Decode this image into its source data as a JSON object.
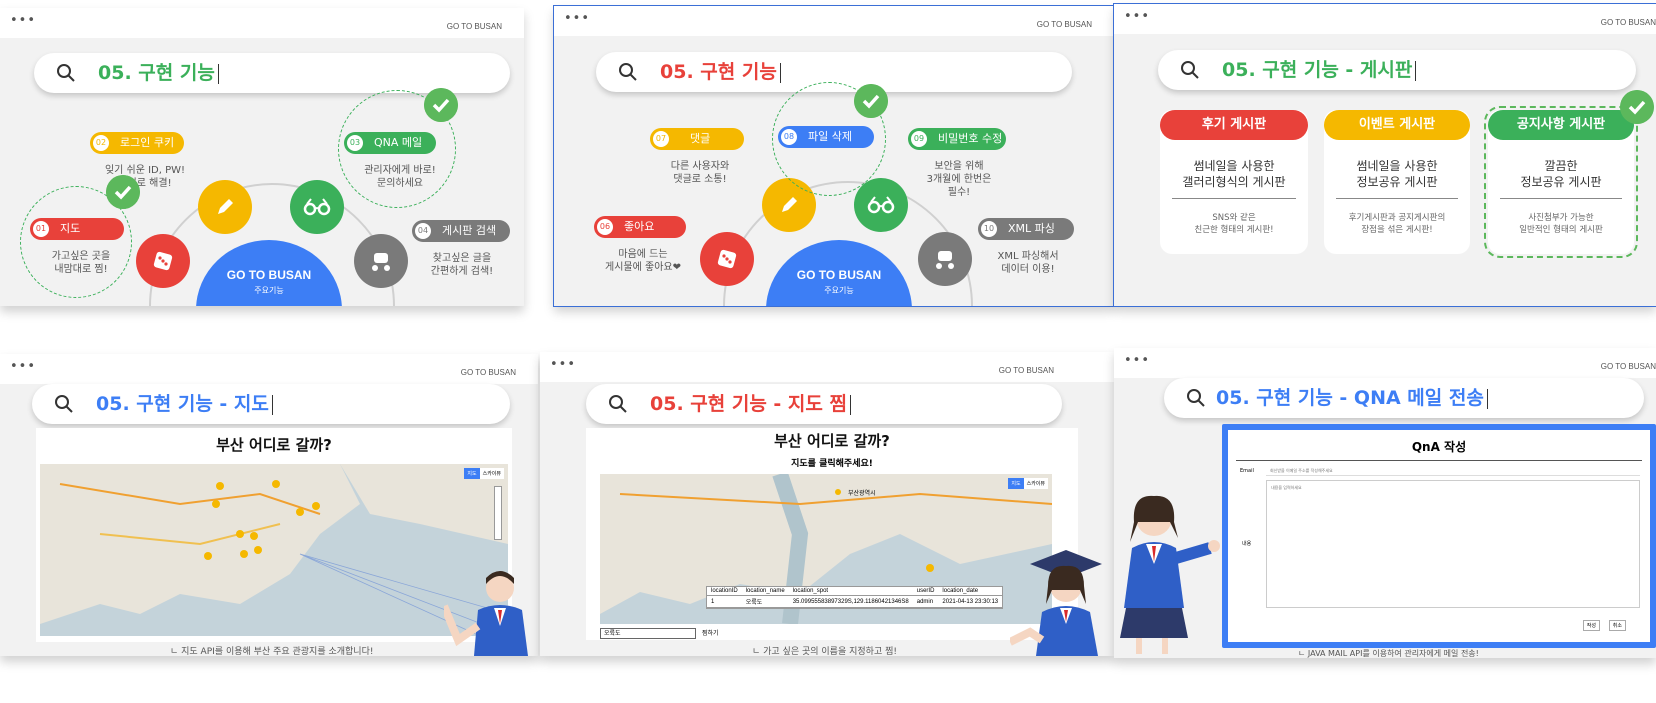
{
  "brand": "GO TO BUSAN",
  "slides": {
    "s1": {
      "title": "05. 구현 기능",
      "features": [
        {
          "num": "01",
          "label": "지도",
          "desc1": "가고싶은 곳을",
          "desc2": "내맘대로 찜!"
        },
        {
          "num": "02",
          "label": "로그인 쿠키",
          "desc1": "잊기 쉬운 ID, PW!",
          "desc2": "쿠키로 해결!"
        },
        {
          "num": "03",
          "label": "QNA 메일",
          "desc1": "관리자에게 바로!",
          "desc2": "문의하세요"
        },
        {
          "num": "04",
          "label": "게시판 검색",
          "desc1": "찾고싶은 글을",
          "desc2": "간편하게 검색!"
        }
      ],
      "hub_title": "GO TO BUSAN",
      "hub_sub": "주요기능"
    },
    "s2": {
      "title": "05. 구현 기능",
      "features": [
        {
          "num": "06",
          "label": "좋아요",
          "desc1": "마음에 드는",
          "desc2": "게시물에 좋아요❤"
        },
        {
          "num": "07",
          "label": "댓글",
          "desc1": "다른 사용자와",
          "desc2": "댓글로 소통!"
        },
        {
          "num": "08",
          "label": "파일 삭제",
          "desc1": "",
          "desc2": ""
        },
        {
          "num": "09",
          "label": "비밀번호 수정",
          "desc1": "보안을 위해",
          "desc2": "3개월에 한번은",
          "desc3": "필수!"
        },
        {
          "num": "10",
          "label": "XML 파싱",
          "desc1": "XML 파싱해서",
          "desc2": "데이터 이용!"
        }
      ],
      "hub_title": "GO TO BUSAN",
      "hub_sub": "주요기능"
    },
    "s3": {
      "title": "05. 구현 기능 - 게시판",
      "cards": [
        {
          "head": "후기 게시판",
          "main1": "썸네일을 사용한",
          "main2": "갤러리형식의 게시판",
          "sub1": "SNS와 같은",
          "sub2": "친근한 형태의 게시판!"
        },
        {
          "head": "이벤트 게시판",
          "main1": "썸네일을 사용한",
          "main2": "정보공유 게시판",
          "sub1": "후기게시판과 공지게시판의",
          "sub2": "장점을 섞은 게시판!"
        },
        {
          "head": "공지사항 게시판",
          "main1": "깔끔한",
          "main2": "정보공유 게시판",
          "sub1": "사진첨부가 가능한",
          "sub2": "일반적인 형태의 게시판"
        }
      ]
    },
    "s4": {
      "title": "05. 구현 기능 - 지도",
      "map_title": "부산 어디로 갈까?",
      "caption": "ㄴ 지도 API를 이용해 부산 주요 관광지를 소개합니다!",
      "map_toggle": [
        "지도",
        "스카이뷰"
      ]
    },
    "s5": {
      "title": "05. 구현 기능 - 지도 찜",
      "map_title": "부산 어디로 갈까?",
      "map_subtitle": "지도를 클릭해주세요!",
      "map_label": "부산광역시",
      "table_headers": [
        "locationID",
        "location_name",
        "location_spot",
        "userID",
        "location_date"
      ],
      "table_row": [
        "1",
        "오륙도",
        "35.09955583897329S,129.11860421346S8",
        "admin",
        "2021-04-13 23:30:13"
      ],
      "input_value": "오륙도",
      "button_label": "찜하기",
      "caption": "ㄴ 가고 싶은 곳의 이름을 지정하고 찜!"
    },
    "s6": {
      "title": "05. 구현 기능 - QNA 메일 전송",
      "form_title": "QnA 작성",
      "email_label": "Email",
      "email_placeholder": "회신받을 이메일 주소를 작성해주세요",
      "content_label": "내용",
      "content_placeholder": "내용을 입력하세요",
      "submit_label": "작성",
      "cancel_label": "취소",
      "caption": "ㄴ JAVA MAIL API를 이용하여 관리자에게 메일 전송!"
    }
  },
  "colors": {
    "green": "#3bb05a",
    "red": "#e8413a",
    "yellow": "#f5b800",
    "blue": "#3d7ef5",
    "gray": "#7a7a7a"
  }
}
